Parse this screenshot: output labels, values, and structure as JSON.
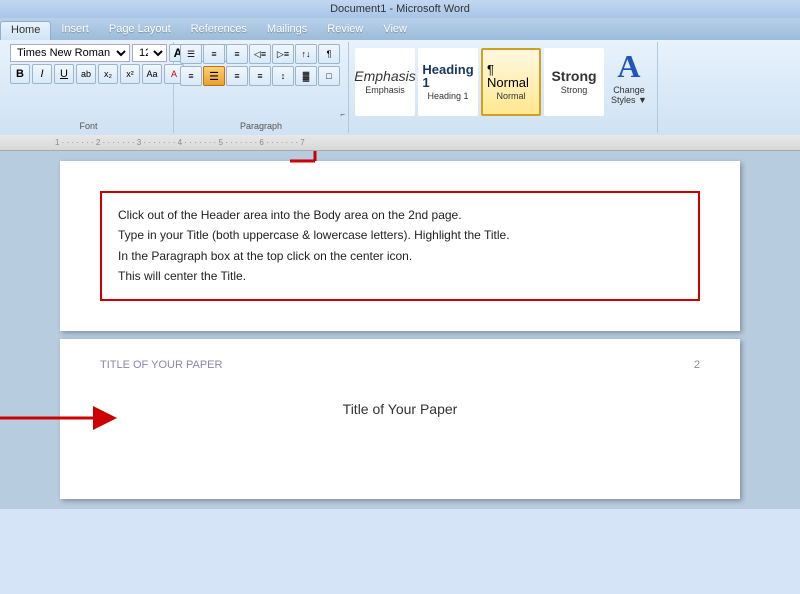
{
  "titlebar": {
    "text": "Document1 - Microsoft Word"
  },
  "ribbon": {
    "tabs": [
      "Home",
      "Insert",
      "Page Layout",
      "References",
      "Mailings",
      "Review",
      "View"
    ],
    "active_tab": "Home"
  },
  "font_group": {
    "label": "Font",
    "font_name": "Times New Roman",
    "font_size": "12",
    "buttons": {
      "grow": "A",
      "shrink": "A",
      "bold": "B",
      "italic": "I",
      "underline": "U",
      "subscript": "x₂",
      "superscript": "x²",
      "clear": "Aa",
      "color": "A"
    }
  },
  "paragraph_group": {
    "label": "Paragraph",
    "row1": [
      "≡•",
      "≡•",
      "≡",
      "¶≡",
      "↓≡",
      "↑≡",
      "¶"
    ],
    "row2_align": [
      "≡",
      "≡",
      "≡",
      "≡"
    ],
    "row2_other": [
      "↕",
      "≡",
      "▼",
      "▼"
    ],
    "center_highlighted": true
  },
  "styles_group": {
    "label": "Styles",
    "items": [
      {
        "id": "emphasis",
        "preview": "Emphasis",
        "label": "Emphasis",
        "active": false
      },
      {
        "id": "heading1",
        "preview": "Heading 1",
        "label": "Heading 1",
        "active": false
      },
      {
        "id": "normal",
        "preview": "¶ Normal",
        "label": "Normal",
        "active": true
      },
      {
        "id": "strong",
        "preview": "Strong",
        "label": "Strong",
        "active": false
      }
    ],
    "change_styles_label": "Change\nStyles ▼"
  },
  "instructions": {
    "line1": "Click out of the Header area into the Body area on the 2nd page.",
    "line2": "Type in your Title (both uppercase & lowercase letters). Highlight the Title.",
    "line3": "In the Paragraph box at the top click on the center icon.",
    "line4": "This will center the Title."
  },
  "page2": {
    "header_left": "TITLE OF YOUR PAPER",
    "page_number": "2",
    "title": "Title of Your Paper"
  }
}
